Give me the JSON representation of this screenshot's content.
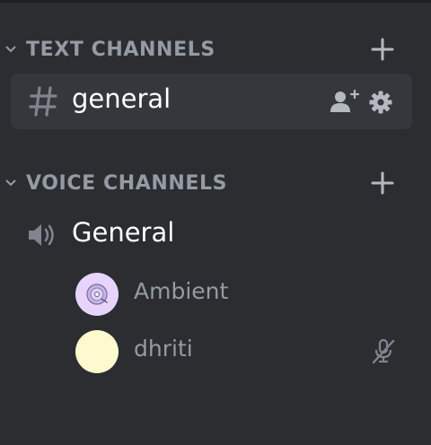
{
  "categories": {
    "text": {
      "label": "TEXT CHANNELS"
    },
    "voice": {
      "label": "VOICE CHANNELS"
    }
  },
  "text_channel": {
    "name": "general",
    "selected": true
  },
  "voice_channel": {
    "name": "General"
  },
  "voice_users": [
    {
      "name": "Ambient",
      "avatar_color": "#e6d4fb",
      "muted": false
    },
    {
      "name": "dhriti",
      "avatar_color": "#fff9cf",
      "muted": true
    }
  ],
  "colors": {
    "background": "#2b2d31",
    "selected_row": "#35373c",
    "muted_text": "#949ba4",
    "active_text": "#ffffff"
  }
}
